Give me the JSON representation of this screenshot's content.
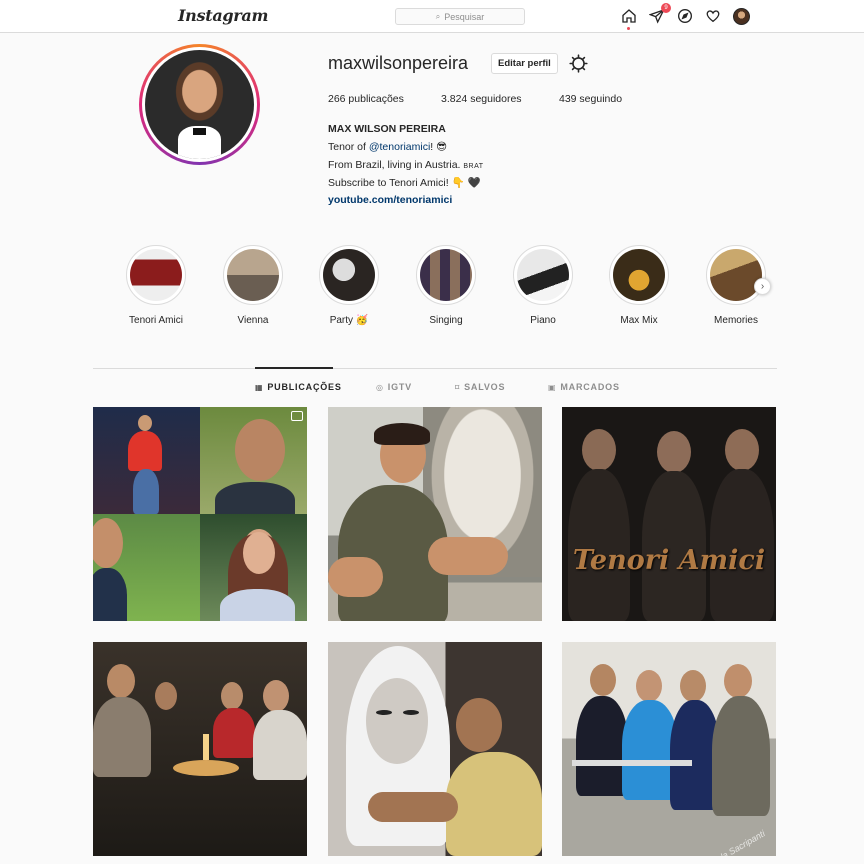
{
  "nav": {
    "logo": "Instagram",
    "search_placeholder": "Pesquisar",
    "activity_badge": "9"
  },
  "profile": {
    "username": "maxwilsonpereira",
    "edit_label": "Editar perfil",
    "stats": {
      "posts": "266 publicações",
      "followers": "3.824 seguidores",
      "following": "439 seguindo"
    },
    "full_name": "MAX WILSON PEREIRA",
    "bio": {
      "line1_prefix": "Tenor of ",
      "line1_mention": "@tenoriamici",
      "line1_suffix": "! 😎",
      "line2_text": "From Brazil, living in Austria. ",
      "line2_flag": "BRAT",
      "line3": "Subscribe to Tenori Amici! 👇 🖤",
      "link": "youtube.com/tenoriamici"
    }
  },
  "highlights": [
    {
      "label": "Tenori Amici"
    },
    {
      "label": "Vienna"
    },
    {
      "label": "Party 🥳"
    },
    {
      "label": "Singing"
    },
    {
      "label": "Piano"
    },
    {
      "label": "Max Mix"
    },
    {
      "label": "Memories"
    }
  ],
  "tabs": [
    {
      "label": "PUBLICAÇÕES",
      "icon": "grid-icon",
      "active": true
    },
    {
      "label": "IGTV",
      "icon": "igtv-icon",
      "active": false
    },
    {
      "label": "SALVOS",
      "icon": "bookmark-icon",
      "active": false
    },
    {
      "label": "MARCADOS",
      "icon": "tagged-icon",
      "active": false
    }
  ],
  "posts": [
    {
      "kind": "collage",
      "carousel": true
    },
    {
      "kind": "statue-flex"
    },
    {
      "kind": "tenors",
      "overlay_text": "Tenori Amici"
    },
    {
      "kind": "bar-group"
    },
    {
      "kind": "nun-poster"
    },
    {
      "kind": "cafe-group",
      "watermark": "la Sacripanti"
    }
  ],
  "colors": {
    "link": "#00376b",
    "badge": "#ed4956",
    "border": "#dbdbdb",
    "muted": "#8e8e8e"
  }
}
